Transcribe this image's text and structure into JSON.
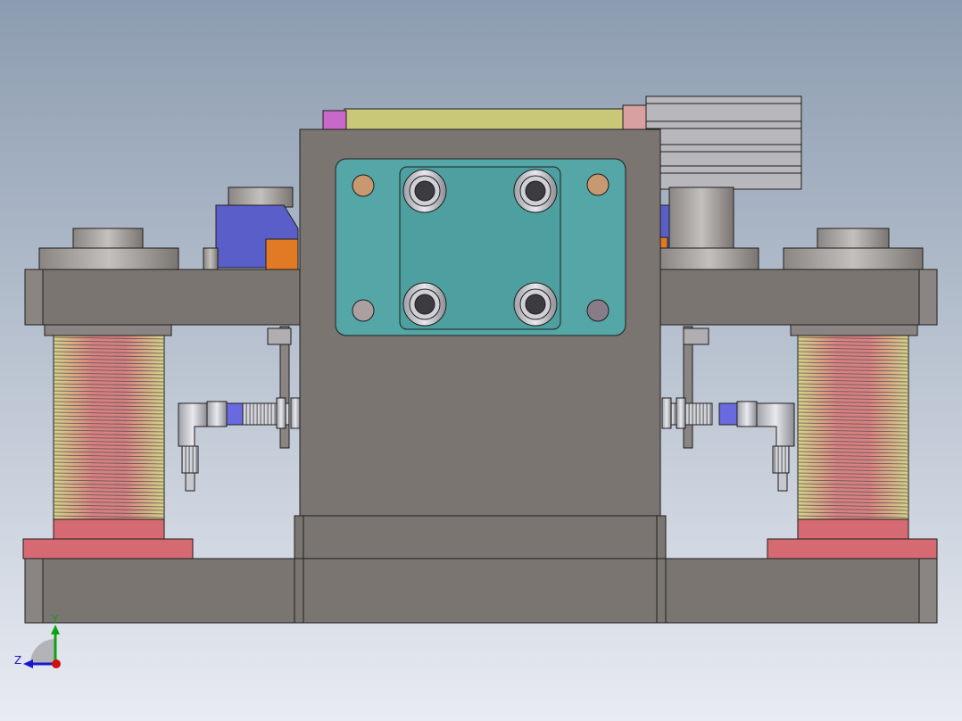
{
  "viewport": {
    "background_top": "#8c9cb0",
    "background_bottom": "#e8ebf2"
  },
  "colors": {
    "body_gray": "#7a7571",
    "body_gray_dark": "#5f5a57",
    "outline": "#1e1e1e",
    "teal_plate": "#55a6a6",
    "coil_red": "#d98080",
    "coil_yellow": "#d8d48a",
    "pad_red": "#d66a72",
    "block_blue": "#5a5ec8",
    "block_orange": "#e07a24",
    "top_yellow": "#c8c878",
    "top_magenta": "#c868c8",
    "top_pink": "#d8a0a0",
    "stack_gray": "#b8b8bc",
    "hole_tan": "#c89870",
    "hole_mauve": "#887c88",
    "axis_x": "#d01010",
    "axis_y": "#10a010",
    "axis_z": "#1818d0"
  },
  "icons": {
    "triad": "coordinate-triad-icon"
  },
  "triad": {
    "y_label": "Y",
    "z_label": "Z"
  }
}
